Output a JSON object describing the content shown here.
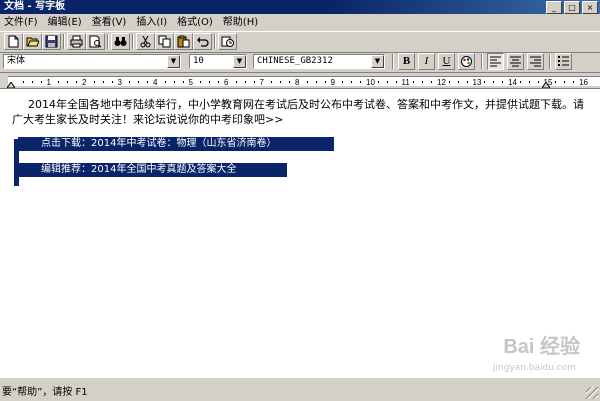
{
  "window": {
    "title": "文档 - 写字板",
    "buttons": {
      "minimize": "_",
      "maximize": "□",
      "close": "×"
    }
  },
  "menubar": {
    "items": [
      {
        "label": "文件(F)"
      },
      {
        "label": "编辑(E)"
      },
      {
        "label": "查看(V)"
      },
      {
        "label": "插入(I)"
      },
      {
        "label": "格式(O)"
      },
      {
        "label": "帮助(H)"
      }
    ]
  },
  "toolbar": {
    "icons": [
      "new-document-icon",
      "open-folder-icon",
      "save-disk-icon",
      "print-icon",
      "print-preview-icon",
      "find-binoculars-icon",
      "cut-scissors-icon",
      "copy-icon",
      "paste-icon",
      "undo-icon",
      "insert-datetime-icon"
    ]
  },
  "formatbar": {
    "font_name": "宋体",
    "font_size": "10",
    "charset": "CHINESE_GB2312",
    "bold_label": "B",
    "italic_label": "I",
    "underline_label": "U"
  },
  "ruler": {
    "numbers": [
      "1",
      "2",
      "3",
      "4",
      "5",
      "6",
      "7",
      "8",
      "9",
      "10",
      "11",
      "12",
      "13",
      "14",
      "15",
      "16"
    ]
  },
  "document": {
    "paragraph": "2014年全国各地中考陆续举行，中小学教育网在考试后及时公布中考试卷、答案和中考作文，并提供试题下载。请广大考生家长及时关注！来论坛说说你的中考印象吧>>",
    "link1": "点击下载：2014年中考试卷：物理（山东省济南卷）",
    "link2": "编辑推荐：2014年全国中考真题及答案大全"
  },
  "watermark": {
    "brand": "Bai 经验",
    "url": "jingyan.baidu.com"
  },
  "statusbar": {
    "text": "要“帮助”，请按 F1"
  }
}
